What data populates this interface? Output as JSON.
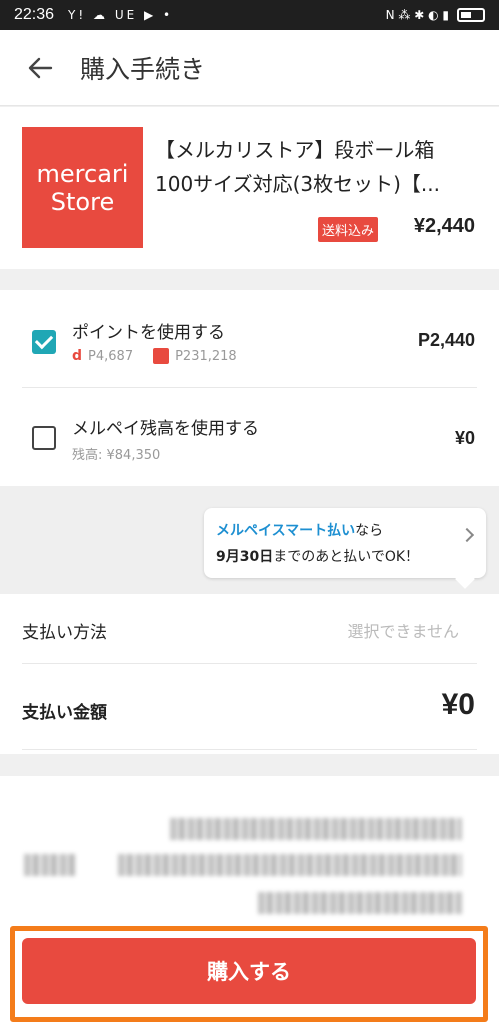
{
  "status_bar": {
    "time": "22:36",
    "icons": "Y! ☁ UE ▶ •",
    "right": "N ⁂ ✱ ◐ ▮"
  },
  "header": {
    "title": "購入手続き",
    "back_icon": "arrow-left-icon"
  },
  "item": {
    "logo_line1": "mercari",
    "logo_line2": "Store",
    "name": "【メルカリストア】段ボール箱 100サイズ対応(3枚セット)【...",
    "shipping_badge": "送料込み",
    "price": "¥2,440"
  },
  "payment_options": [
    {
      "label": "ポイントを使用する",
      "checked": true,
      "d_points": "P4,687",
      "mercari_points": "P231,218",
      "amount": "P2,440"
    },
    {
      "label": "メルペイ残高を使用する",
      "checked": false,
      "balance": "残高: ¥84,350",
      "amount": "¥0"
    }
  ],
  "promo": {
    "highlight": "メルペイスマート払い",
    "line1_rest": "なら",
    "date": "9月30日",
    "line2_rest": "までのあと払いでOK！"
  },
  "summary": {
    "method_label": "支払い方法",
    "method_value": "選択できません",
    "total_label": "支払い金額",
    "total_value": "¥0"
  },
  "footer": {
    "buy_label": "購入する"
  },
  "colors": {
    "brand_red": "#e84a3f",
    "check_teal": "#20a7b5",
    "link_blue": "#1d8fd1",
    "highlight_orange": "#f47c1a"
  }
}
